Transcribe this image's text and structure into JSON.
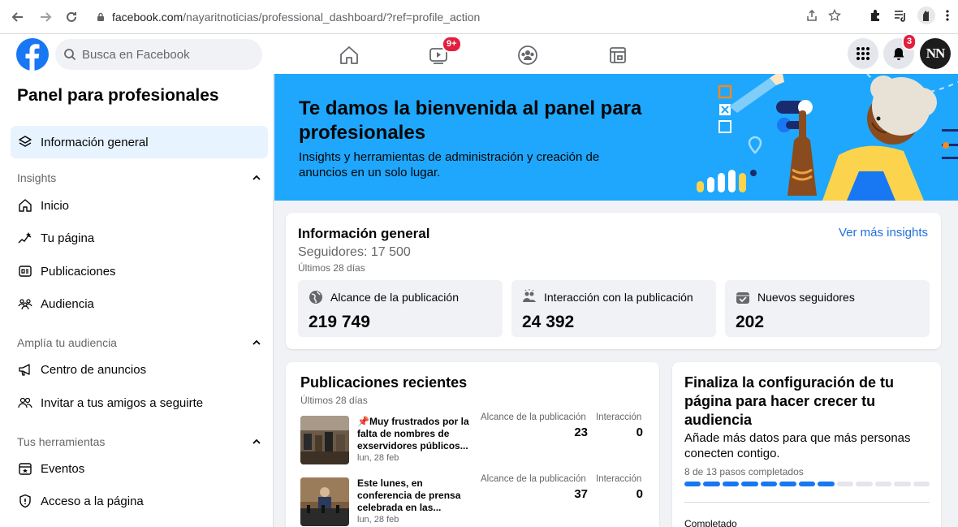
{
  "browser": {
    "url_domain": "facebook.com",
    "url_path": "/nayaritnoticias/professional_dashboard/?ref=profile_action"
  },
  "topbar": {
    "search_placeholder": "Busca en Facebook",
    "watch_badge": "9+",
    "notifications_badge": "3",
    "avatar_initials": "NN"
  },
  "sidebar": {
    "title": "Panel para profesionales",
    "general": "Información general",
    "section_insights": "Insights",
    "insights_items": [
      "Inicio",
      "Tu página",
      "Publicaciones",
      "Audiencia"
    ],
    "section_audience": "Amplía tu audiencia",
    "audience_items": [
      "Centro de anuncios",
      "Invitar a tus amigos a seguirte"
    ],
    "section_tools": "Tus herramientas",
    "tools_items": [
      "Eventos",
      "Acceso a la página"
    ]
  },
  "banner": {
    "title": "Te damos la bienvenida al panel para profesionales",
    "subtitle": "Insights y herramientas de administración y creación de anuncios en un solo lugar."
  },
  "overview": {
    "title": "Información general",
    "more_link": "Ver más insights",
    "followers": "Seguidores: 17 500",
    "period": "Últimos 28 días",
    "metrics": [
      {
        "label": "Alcance de la publicación",
        "value": "219 749"
      },
      {
        "label": "Interacción con la publicación",
        "value": "24 392"
      },
      {
        "label": "Nuevos seguidores",
        "value": "202"
      }
    ]
  },
  "recent_posts": {
    "title": "Publicaciones recientes",
    "period": "Últimos 28 días",
    "col_reach": "Alcance de la publicación",
    "col_interaction": "Interacción",
    "posts": [
      {
        "text": "📌Muy frustrados por la falta de nombres de exservidores públicos...",
        "date": "lun, 28 feb",
        "reach": "23",
        "interaction": "0"
      },
      {
        "text": "Este lunes, en conferencia de prensa celebrada en las...",
        "date": "lun, 28 feb",
        "reach": "37",
        "interaction": "0"
      }
    ]
  },
  "setup": {
    "title": "Finaliza la configuración de tu página para hacer crecer tu audiencia",
    "description": "Añade más datos para que más personas conecten contigo.",
    "steps_text": "8 de 13 pasos completados",
    "steps_total": 13,
    "steps_done": 8,
    "completed_label": "Completado"
  },
  "colors": {
    "brand": "#1877f2",
    "banner": "#1ea7fd",
    "badge": "#e41e3f",
    "link": "#216fdb"
  }
}
